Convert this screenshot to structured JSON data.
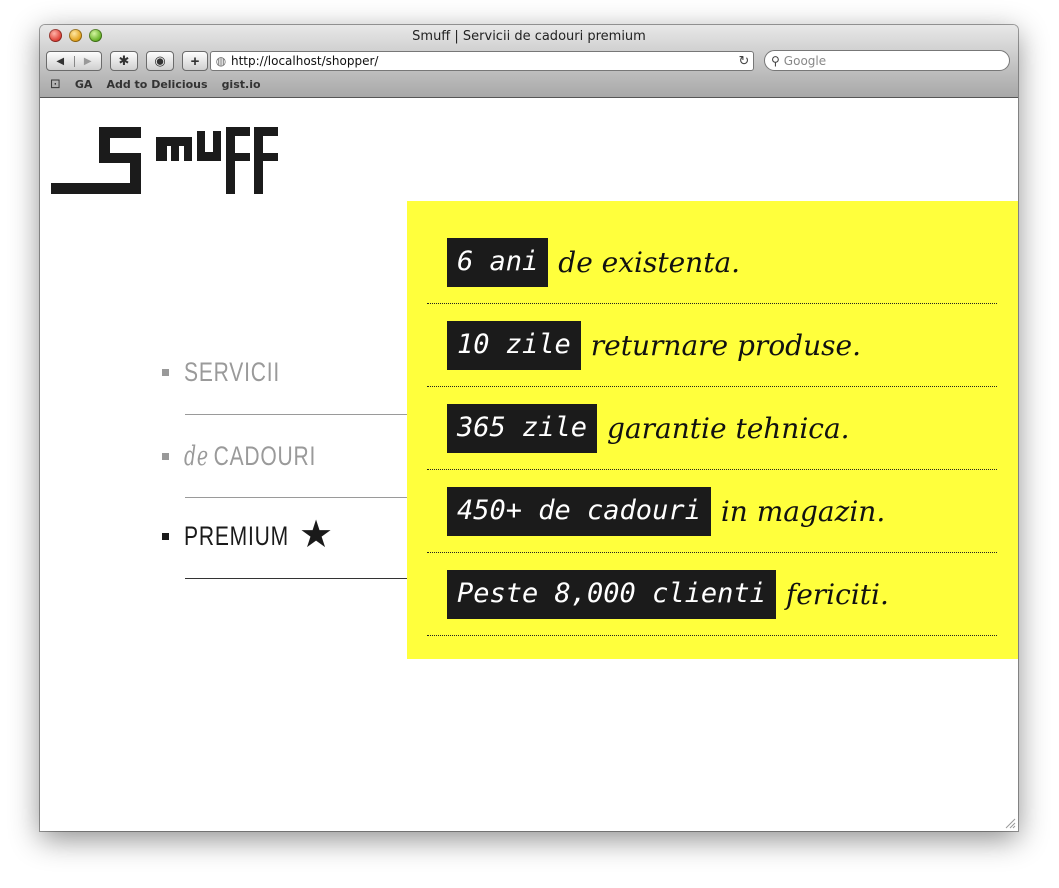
{
  "window": {
    "title": "Smuff | Servicii de cadouri premium",
    "url": "http://localhost/shopper/",
    "search_placeholder": "Google"
  },
  "bookmarks": [
    "GA",
    "Add to Delicious",
    "gist.io"
  ],
  "menu": {
    "items": [
      {
        "label": "SERVICII",
        "state": "muted"
      },
      {
        "prefix": "de",
        "label": "CADOURI",
        "state": "muted"
      },
      {
        "label": "PREMIUM",
        "state": "active"
      }
    ]
  },
  "facts": [
    {
      "highlight": "6 ani",
      "text": "de existenta."
    },
    {
      "highlight": "10 zile",
      "text": "returnare produse."
    },
    {
      "highlight": "365 zile",
      "text": "garantie tehnica."
    },
    {
      "highlight": "450+ de cadouri",
      "text": "in magazin."
    },
    {
      "highlight": "Peste 8,000 clienti",
      "text": "fericiti."
    }
  ],
  "colors": {
    "panel": "#ffff3c",
    "highlight_bg": "#1b1b1b",
    "muted_text": "#9a9a9a"
  },
  "icons": [
    "back-icon",
    "forward-icon",
    "bug-icon",
    "camera-icon",
    "add-icon",
    "globe-icon",
    "reload-icon",
    "search-icon",
    "bookmarks-book-icon",
    "star-icon"
  ]
}
